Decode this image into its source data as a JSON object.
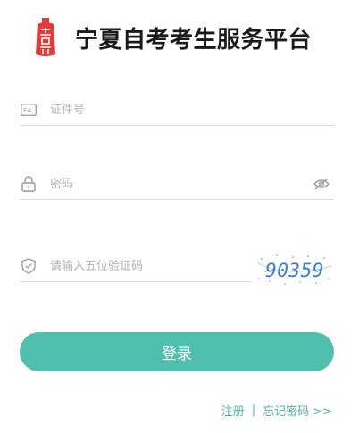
{
  "header": {
    "title": "宁夏自考考生服务平台",
    "logo_icon": "red-seal-logo"
  },
  "form": {
    "id_field": {
      "placeholder": "证件号",
      "value": "",
      "icon": "id-card-icon"
    },
    "password_field": {
      "placeholder": "密码",
      "value": "",
      "icon": "lock-icon",
      "toggle_icon": "eye-slash-icon"
    },
    "captcha_field": {
      "placeholder": "请输入五位验证码",
      "value": "",
      "icon": "shield-check-icon"
    },
    "captcha_text": "90359",
    "login_label": "登录"
  },
  "links": {
    "register": "注册",
    "separator": "|",
    "forgot": "忘记密码 >>"
  },
  "colors": {
    "accent": "#4fc0ad",
    "link": "#4fb5a5",
    "logo_red": "#e23b3b"
  }
}
